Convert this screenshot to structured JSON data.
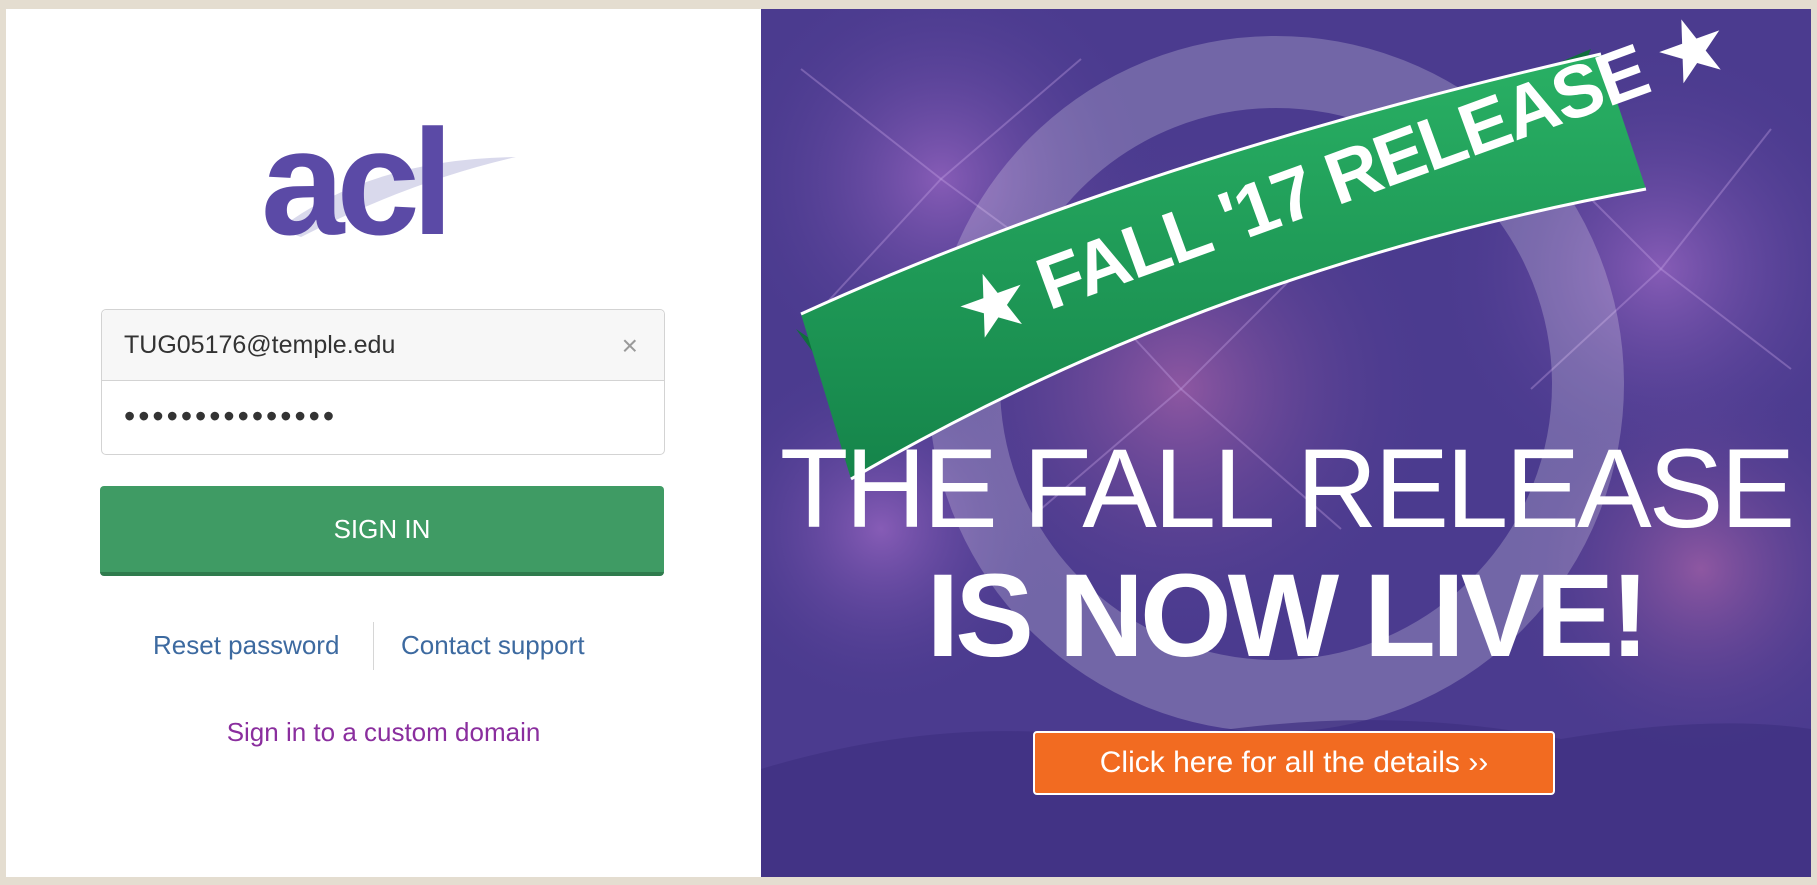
{
  "brand": {
    "logo_text": "acl"
  },
  "login": {
    "email_value": "TUG05176@temple.edu",
    "password_value": "•••••••••••••••",
    "clear_glyph": "×",
    "sign_in_label": "SIGN IN",
    "reset_password_label": "Reset password",
    "contact_support_label": "Contact support",
    "custom_domain_label": "Sign in to a custom domain"
  },
  "promo": {
    "ribbon_text": "★ FALL '17 RELEASE ★",
    "headline_line1": "THE FALL RELEASE",
    "headline_line2": "IS NOW LIVE!",
    "details_button_label": "Click here for all the details ››"
  },
  "colors": {
    "brand_purple": "#5b4aa6",
    "sign_in_green": "#3f9b64",
    "link_blue": "#3d6aa0",
    "custom_domain_purple": "#8a2e9e",
    "banner_purple": "#4b3b8f",
    "ribbon_green": "#1f9a55",
    "details_orange": "#f26b21"
  }
}
